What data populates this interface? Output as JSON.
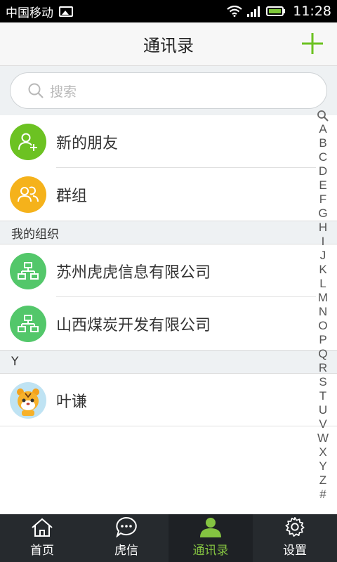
{
  "status_bar": {
    "carrier": "中国移动",
    "time": "11:28"
  },
  "header": {
    "title": "通讯录",
    "add_icon": "plus-icon"
  },
  "search": {
    "placeholder": "搜索"
  },
  "top_items": [
    {
      "label": "新的朋友",
      "icon": "add-friend-icon",
      "color": "#6cc222"
    },
    {
      "label": "群组",
      "icon": "group-icon",
      "color": "#f5b21b"
    }
  ],
  "sections": [
    {
      "title": "我的组织",
      "items": [
        {
          "label": "苏州虎虎信息有限公司",
          "icon": "org-chart-icon",
          "color": "#53c76a"
        },
        {
          "label": "山西煤炭开发有限公司",
          "icon": "org-chart-icon",
          "color": "#53c76a"
        }
      ]
    },
    {
      "title": "Y",
      "items": [
        {
          "label": "叶谦",
          "icon": "tiger-avatar"
        }
      ]
    }
  ],
  "index_letters": [
    "A",
    "B",
    "C",
    "D",
    "E",
    "F",
    "G",
    "H",
    "I",
    "J",
    "K",
    "L",
    "M",
    "N",
    "O",
    "P",
    "Q",
    "R",
    "S",
    "T",
    "U",
    "V",
    "W",
    "X",
    "Y",
    "Z",
    "#"
  ],
  "tabs": [
    {
      "label": "首页",
      "icon": "home-icon"
    },
    {
      "label": "虎信",
      "icon": "chat-icon"
    },
    {
      "label": "通讯录",
      "icon": "contacts-icon",
      "active": true
    },
    {
      "label": "设置",
      "icon": "gear-icon"
    }
  ],
  "colors": {
    "accent": "#84c341",
    "tabbar": "#262a2e"
  }
}
